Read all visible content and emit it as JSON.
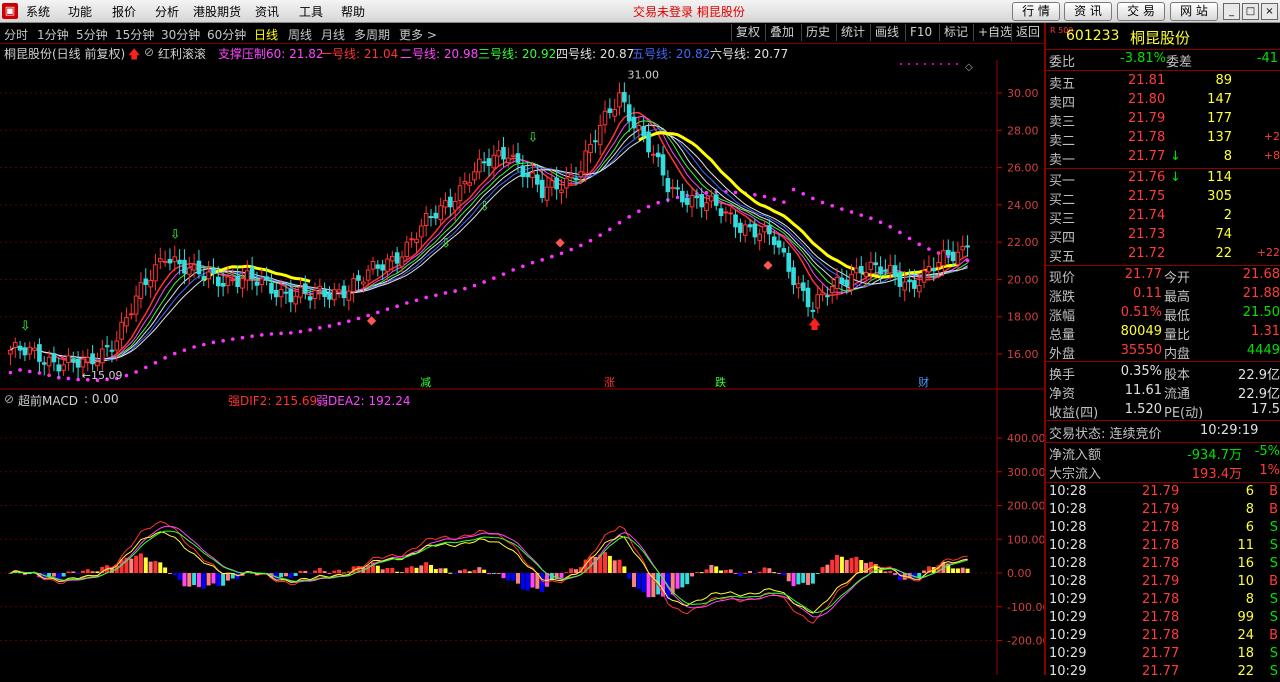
{
  "menu": {
    "items": [
      "系统",
      "功能",
      "报价",
      "分析",
      "港股期货",
      "资讯",
      "工具",
      "帮助"
    ],
    "status": "交易未登录  桐昆股份",
    "right_buttons": [
      "行 情",
      "资 讯",
      "交 易",
      "网 站"
    ]
  },
  "toolbar": {
    "periods": [
      "分时",
      "1分钟",
      "5分钟",
      "15分钟",
      "30分钟",
      "60分钟",
      "日线",
      "周线",
      "月线",
      "多周期",
      "更多 >"
    ],
    "active_period": "日线",
    "tools": [
      "复权",
      "叠加",
      "历史",
      "统计",
      "画线",
      "F10",
      "标记",
      "+自选",
      "返回"
    ]
  },
  "main_chart": {
    "title": "桐昆股份(日线 前复权)",
    "indicator": "红利滚滚",
    "lines": [
      {
        "label": "支撑压制60: 21.82",
        "color": "#ff44ff"
      },
      {
        "label": "一号线: 21.04",
        "color": "#ff3333"
      },
      {
        "label": "二号线: 20.98",
        "color": "#ff44ff"
      },
      {
        "label": "三号线: 20.92",
        "color": "#33ff33"
      },
      {
        "label": "四号线: 20.87",
        "color": "#e0e0e0"
      },
      {
        "label": "五号线: 20.82",
        "color": "#4466ff"
      },
      {
        "label": "六号线: 20.77",
        "color": "#e0e0e0"
      }
    ],
    "y_ticks": [
      "30.00",
      "28.00",
      "26.00",
      "24.00",
      "22.00",
      "20.00",
      "18.00",
      "16.00"
    ],
    "high_label": "31.00",
    "low_label": "←15.09",
    "markers": [
      "减",
      "涨",
      "跌",
      "财"
    ]
  },
  "sub_chart": {
    "title": "超前MACD",
    "value": ": 0.00",
    "dif_label": "强DIF2: 215.69",
    "dea_label": "弱DEA2: 192.24",
    "y_ticks": [
      "400.00",
      "300.00",
      "200.00",
      "100.00",
      "0.00",
      "-100.00",
      "-200.00"
    ]
  },
  "quote": {
    "code": "601233",
    "name": "桐昆股份",
    "tag": "R 500",
    "webi_label": "委比",
    "webi_value": "-3.81%",
    "weicha_label": "委差",
    "weicha_value": "-41",
    "asks": [
      {
        "label": "卖五",
        "price": "21.81",
        "vol": "89",
        "chg": ""
      },
      {
        "label": "卖四",
        "price": "21.80",
        "vol": "147",
        "chg": ""
      },
      {
        "label": "卖三",
        "price": "21.79",
        "vol": "177",
        "chg": ""
      },
      {
        "label": "卖二",
        "price": "21.78",
        "vol": "137",
        "chg": "+2"
      },
      {
        "label": "卖一",
        "price": "21.77",
        "vol": "8",
        "chg": "+8",
        "arrow": "↓"
      }
    ],
    "bids": [
      {
        "label": "买一",
        "price": "21.76",
        "vol": "114",
        "chg": "",
        "arrow": "↓"
      },
      {
        "label": "买二",
        "price": "21.75",
        "vol": "305",
        "chg": ""
      },
      {
        "label": "买三",
        "price": "21.74",
        "vol": "2",
        "chg": ""
      },
      {
        "label": "买四",
        "price": "21.73",
        "vol": "74",
        "chg": ""
      },
      {
        "label": "买五",
        "price": "21.72",
        "vol": "22",
        "chg": "+22"
      }
    ],
    "stats": [
      {
        "l1": "现价",
        "v1": "21.77",
        "c1": "red",
        "l2": "今开",
        "v2": "21.68",
        "c2": "red"
      },
      {
        "l1": "涨跌",
        "v1": "0.11",
        "c1": "red",
        "l2": "最高",
        "v2": "21.88",
        "c2": "red"
      },
      {
        "l1": "涨幅",
        "v1": "0.51%",
        "c1": "red",
        "l2": "最低",
        "v2": "21.50",
        "c2": "green"
      },
      {
        "l1": "总量",
        "v1": "80049",
        "c1": "yellow",
        "l2": "量比",
        "v2": "1.31",
        "c2": "red"
      },
      {
        "l1": "外盘",
        "v1": "35550",
        "c1": "red",
        "l2": "内盘",
        "v2": "4449",
        "c2": "green"
      }
    ],
    "stats2": [
      {
        "l1": "换手",
        "v1": "0.35%",
        "l2": "股本",
        "v2": "22.9亿"
      },
      {
        "l1": "净资",
        "v1": "11.61",
        "l2": "流通",
        "v2": "22.9亿"
      },
      {
        "l1": "收益(四)",
        "v1": "1.520",
        "l2": "PE(动)",
        "v2": "17.5"
      }
    ],
    "trade_state_label": "交易状态: 连续竞价",
    "trade_time": "10:29:19",
    "flows": [
      {
        "label": "净流入额",
        "value": "-934.7万",
        "pct": "-5%",
        "c": "green"
      },
      {
        "label": "大宗流入",
        "value": "193.4万",
        "pct": "1%",
        "c": "red"
      }
    ],
    "ticks": [
      {
        "t": "10:28",
        "p": "21.79",
        "v": "6",
        "s": "B"
      },
      {
        "t": "10:28",
        "p": "21.79",
        "v": "8",
        "s": "B"
      },
      {
        "t": "10:28",
        "p": "21.78",
        "v": "6",
        "s": "S"
      },
      {
        "t": "10:28",
        "p": "21.78",
        "v": "11",
        "s": "S"
      },
      {
        "t": "10:28",
        "p": "21.78",
        "v": "16",
        "s": "S"
      },
      {
        "t": "10:28",
        "p": "21.79",
        "v": "10",
        "s": "B"
      },
      {
        "t": "10:29",
        "p": "21.78",
        "v": "8",
        "s": "S"
      },
      {
        "t": "10:29",
        "p": "21.78",
        "v": "99",
        "s": "S"
      },
      {
        "t": "10:29",
        "p": "21.78",
        "v": "24",
        "s": "B"
      },
      {
        "t": "10:29",
        "p": "21.77",
        "v": "18",
        "s": "S"
      },
      {
        "t": "10:29",
        "p": "21.77",
        "v": "22",
        "s": "S"
      }
    ]
  },
  "chart_data": {
    "type": "candlestick",
    "ylim": [
      14.5,
      31.5
    ],
    "key_points": [
      {
        "i": 0,
        "v": 16.2
      },
      {
        "i": 16,
        "v": 15.3
      },
      {
        "i": 22,
        "v": 17.0
      },
      {
        "i": 32,
        "v": 21.5
      },
      {
        "i": 38,
        "v": 20.2
      },
      {
        "i": 48,
        "v": 20.0
      },
      {
        "i": 62,
        "v": 19.0
      },
      {
        "i": 72,
        "v": 19.8
      },
      {
        "i": 82,
        "v": 21.8
      },
      {
        "i": 95,
        "v": 25.5
      },
      {
        "i": 103,
        "v": 27.0
      },
      {
        "i": 110,
        "v": 24.5
      },
      {
        "i": 118,
        "v": 26.0
      },
      {
        "i": 126,
        "v": 30.0
      },
      {
        "i": 136,
        "v": 25.0
      },
      {
        "i": 148,
        "v": 23.5
      },
      {
        "i": 158,
        "v": 22.0
      },
      {
        "i": 166,
        "v": 18.5
      },
      {
        "i": 176,
        "v": 20.8
      },
      {
        "i": 186,
        "v": 19.8
      },
      {
        "i": 198,
        "v": 21.77
      }
    ],
    "n_bars": 199
  }
}
